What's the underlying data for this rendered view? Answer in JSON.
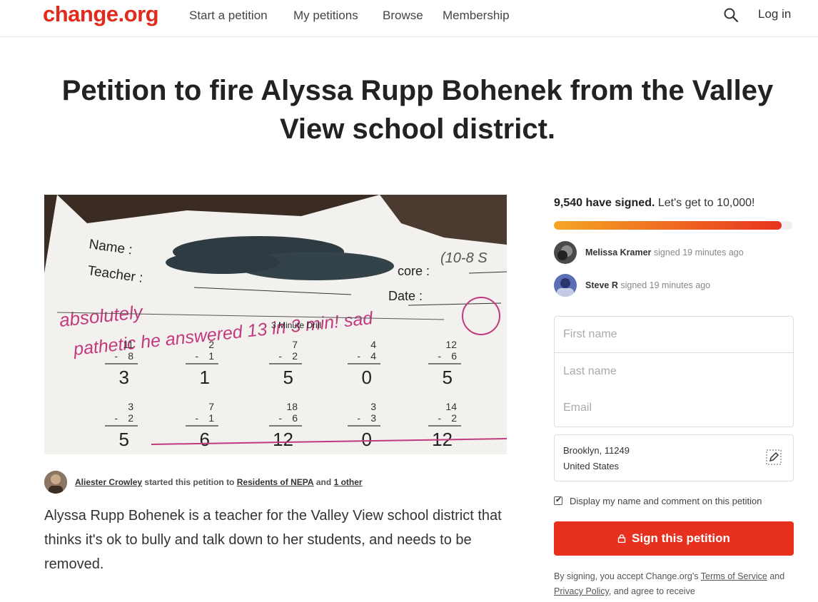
{
  "header": {
    "logo": "change.org",
    "nav": [
      "Start a petition",
      "My petitions",
      "Browse",
      "Membership"
    ],
    "login": "Log in"
  },
  "title": "Petition to fire Alyssa Rupp Bohenek from the Valley View school district.",
  "photo": {
    "labels": {
      "name": "Name :",
      "teacher": "Teacher :",
      "score": "core :",
      "date": "Date :",
      "drill": "3 Minute Drill"
    },
    "handwriting": [
      "absolutely",
      "pathetic he answered 13 in 3 min! sad"
    ],
    "top_right_note": "(10-8 S",
    "problems": [
      {
        "top": "11",
        "bottom": "8",
        "answer": "3"
      },
      {
        "top": "2",
        "bottom": "1",
        "answer": "1"
      },
      {
        "top": "7",
        "bottom": "2",
        "answer": "5"
      },
      {
        "top": "4",
        "bottom": "4",
        "answer": "0"
      },
      {
        "top": "12",
        "bottom": "6",
        "answer": "5"
      }
    ],
    "problems_row2": [
      {
        "top": "3",
        "bottom": "2",
        "answer": "5"
      },
      {
        "top": "7",
        "bottom": "1",
        "answer": "6"
      },
      {
        "top": "18",
        "bottom": "6",
        "answer": "12"
      },
      {
        "top": "3",
        "bottom": "3",
        "answer": "0"
      },
      {
        "top": "14",
        "bottom": "2",
        "answer": "12"
      }
    ]
  },
  "starter": {
    "name": "Aliester Crowley",
    "mid": "started this petition to",
    "target": "Residents of NEPA",
    "and": "and",
    "other": "1 other"
  },
  "body": {
    "paragraph": "Alyssa Rupp Bohenek is a teacher for the Valley View school district that thinks it's ok to bully and talk down to her students, and needs to be removed."
  },
  "progress": {
    "signed": "9,540 have signed.",
    "goal": "Let's get to 10,000!",
    "fraction": 0.954,
    "colors": {
      "start": "#f5a623",
      "end": "#e8331f"
    }
  },
  "signers": [
    {
      "name": "Melissa Kramer",
      "action": "signed 19 minutes ago"
    },
    {
      "name": "Steve R",
      "action": "signed 19 minutes ago"
    }
  ],
  "form": {
    "first_name_placeholder": "First name",
    "last_name_placeholder": "Last name",
    "email_placeholder": "Email",
    "location_city": "Brooklyn, 11249",
    "location_country": "United States",
    "display_label": "Display my name and comment on this petition",
    "sign_button": "Sign this petition",
    "accent": "#e8301f"
  },
  "disclaimer": {
    "prefix": "By signing, you accept Change.org's",
    "terms": "Terms of Service",
    "and": "and",
    "privacy": "Privacy Policy",
    "suffix": ", and agree to receive"
  }
}
